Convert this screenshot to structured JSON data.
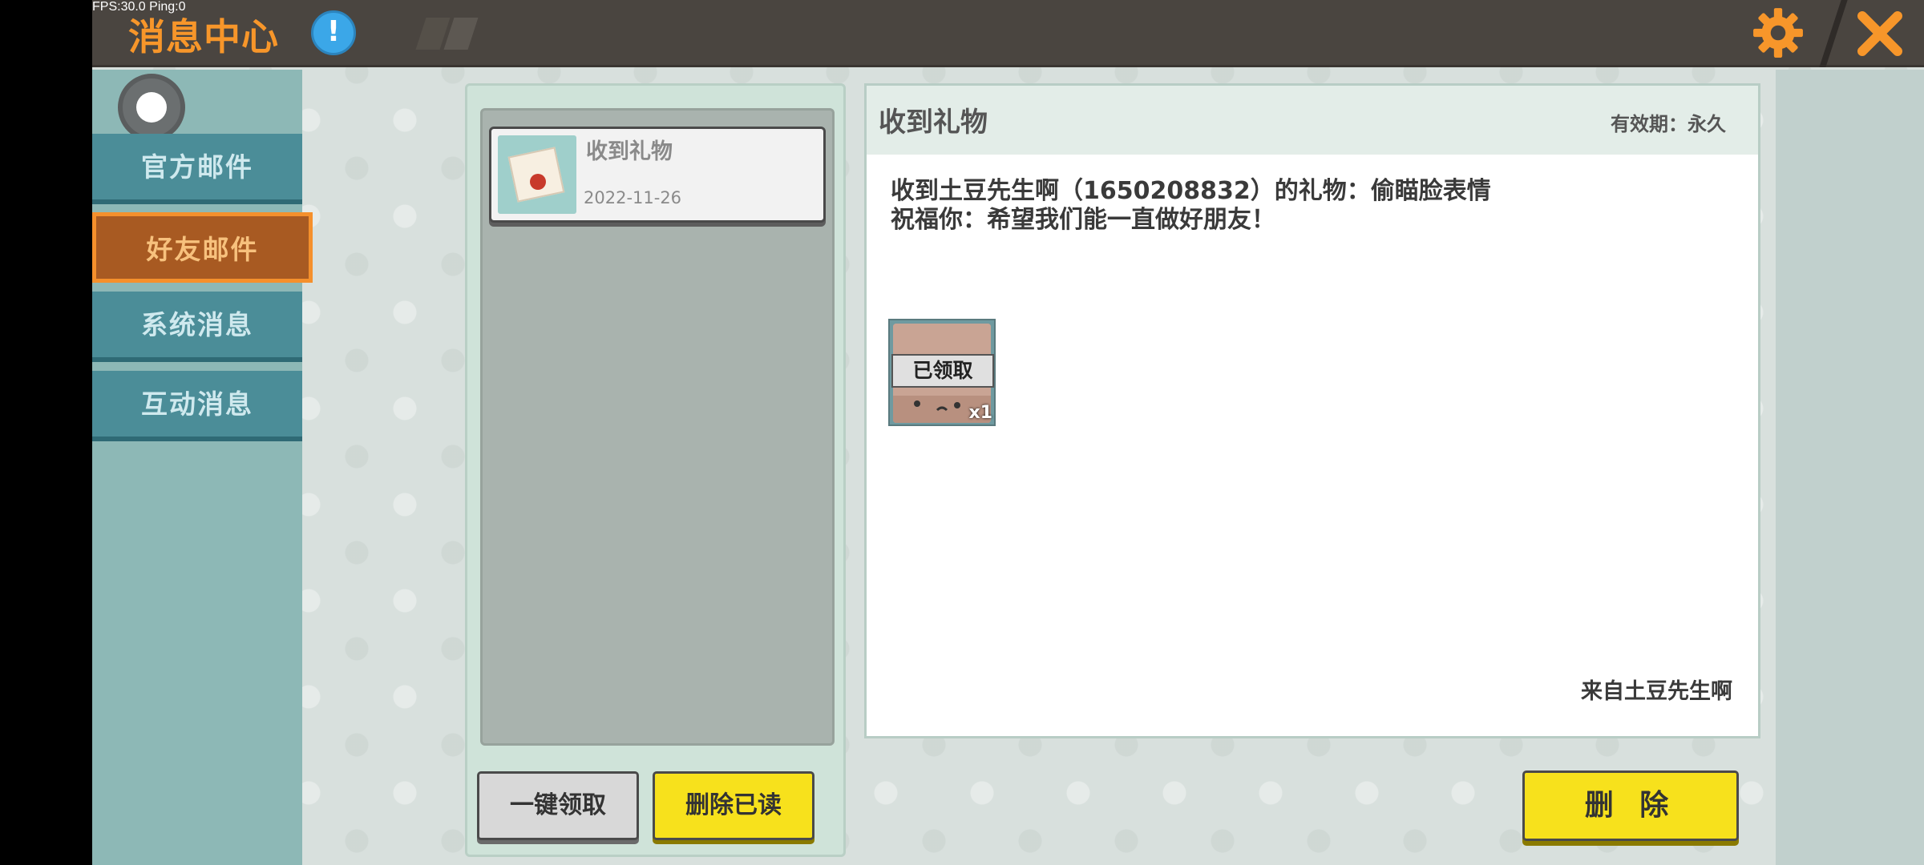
{
  "status_overlay": "FPS:30.0  Ping:0",
  "header": {
    "title": "消息中心",
    "info_symbol": "!",
    "accent_color": "#f7962a"
  },
  "sidebar": {
    "items": [
      {
        "label": "官方邮件",
        "active": false
      },
      {
        "label": "好友邮件",
        "active": true
      },
      {
        "label": "系统消息",
        "active": false
      },
      {
        "label": "互动消息",
        "active": false
      }
    ]
  },
  "mail_list": {
    "items": [
      {
        "title": "收到礼物",
        "date": "2022-11-26",
        "icon": "envelope-icon"
      }
    ],
    "claim_all_label": "一键领取",
    "delete_read_label": "删除已读"
  },
  "detail": {
    "title": "收到礼物",
    "validity": "有效期：永久",
    "body_line1": "收到土豆先生啊（1650208832）的礼物：偷瞄脸表情",
    "body_line2": "祝福你：希望我们能一直做好朋友！",
    "attachment": {
      "status": "已领取",
      "quantity": "x1",
      "icon": "emoji-face-icon"
    },
    "sender": "来自土豆先生啊",
    "delete_label": "删 除"
  },
  "icons": {
    "settings": "gear-icon",
    "close": "close-icon",
    "info": "info-icon"
  }
}
